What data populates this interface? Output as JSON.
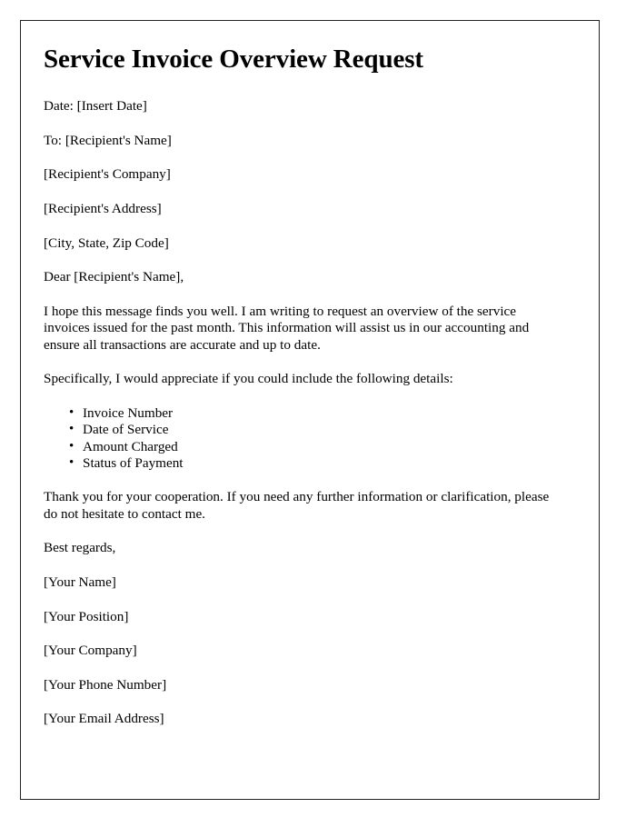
{
  "document": {
    "title": "Service Invoice Overview Request",
    "date_line": "Date: [Insert Date]",
    "recipient": {
      "to_line": "To: [Recipient's Name]",
      "company": "[Recipient's Company]",
      "address": "[Recipient's Address]",
      "city_state_zip": "[City, State, Zip Code]"
    },
    "salutation": "Dear [Recipient's Name],",
    "opening_paragraph": "I hope this message finds you well. I am writing to request an overview of the service invoices issued for the past month. This information will assist us in our accounting and ensure all transactions are accurate and up to date.",
    "request_intro": "Specifically, I would appreciate if you could include the following details:",
    "requested_details": [
      "Invoice Number",
      "Date of Service",
      "Amount Charged",
      "Status of Payment"
    ],
    "closing_paragraph": "Thank you for your cooperation. If you need any further information or clarification, please do not hesitate to contact me.",
    "sign_off": "Best regards,",
    "signature_block": {
      "name": "[Your Name]",
      "position": "[Your Position]",
      "company": "[Your Company]",
      "phone": "[Your Phone Number]",
      "email": "[Your Email Address]"
    }
  }
}
